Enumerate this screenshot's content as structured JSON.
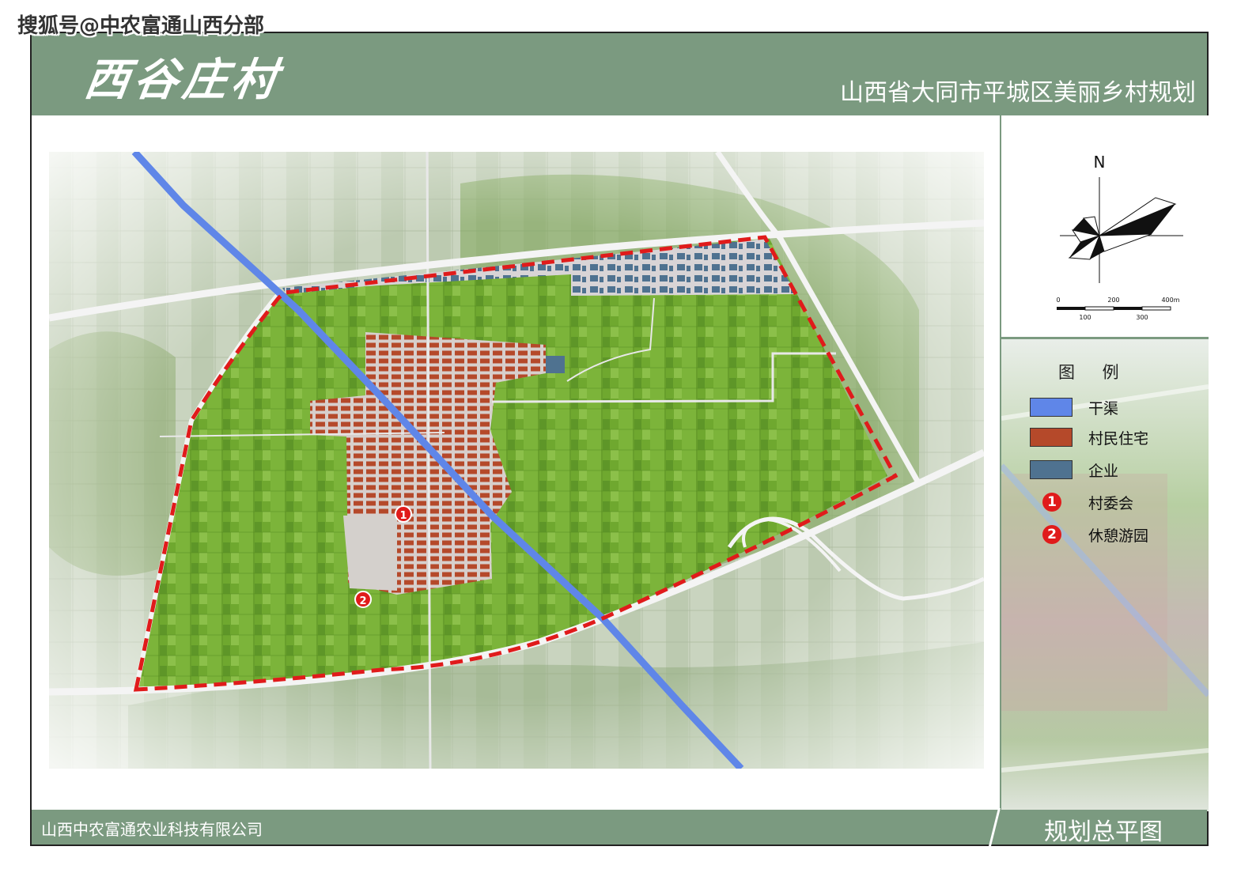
{
  "watermark": "搜狐号@中农富通山西分部",
  "header": {
    "village_name": "西谷庄村",
    "project_title": "山西省大同市平城区美丽乡村规划"
  },
  "compass": {
    "north_label": "N",
    "scale_labels_top": [
      "0",
      "200",
      "400m"
    ],
    "scale_labels_bottom": [
      "100",
      "300"
    ]
  },
  "legend": {
    "title": "图 例",
    "items": [
      {
        "label": "干渠",
        "type": "swatch",
        "color": "#5f86e8"
      },
      {
        "label": "村民住宅",
        "type": "swatch",
        "color": "#b5492a"
      },
      {
        "label": "企业",
        "type": "swatch",
        "color": "#4f7290"
      },
      {
        "label": "村委会",
        "type": "number",
        "number": "1",
        "color": "#e01b1b"
      },
      {
        "label": "休憩游园",
        "type": "number",
        "number": "2",
        "color": "#e01b1b"
      }
    ]
  },
  "map_markers": [
    {
      "number": "1",
      "meaning": "村委会"
    },
    {
      "number": "2",
      "meaning": "休憩游园"
    }
  ],
  "colors": {
    "header_green": "#7b9a80",
    "canal_blue": "#5f86e8",
    "residence": "#b5492a",
    "enterprise": "#4f7290",
    "boundary_red": "#e01b1b",
    "farmland_green": "#6fa82f"
  },
  "footer": {
    "company": "山西中农富通农业科技有限公司",
    "plan_name": "规划总平图"
  }
}
